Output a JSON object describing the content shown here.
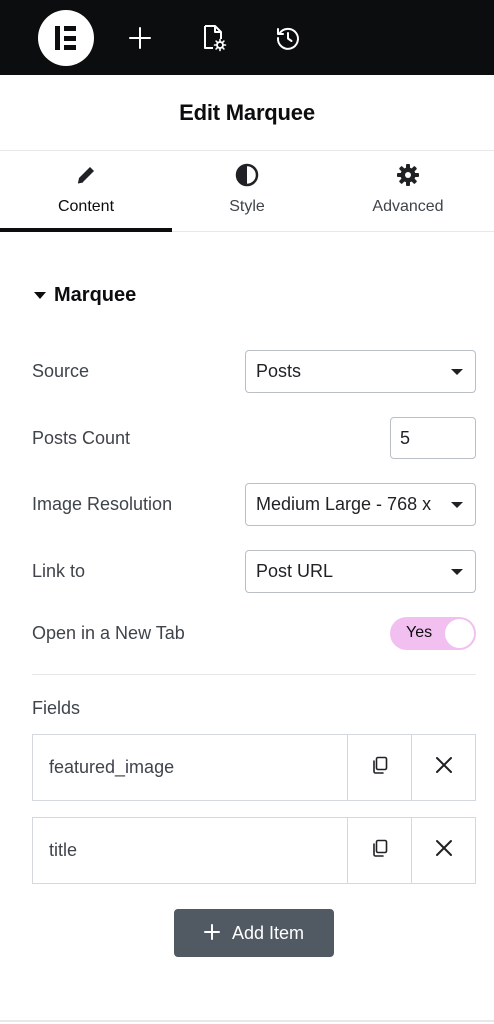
{
  "topbar": {
    "logo": "elementor-logo",
    "icons": [
      "plus-icon",
      "page-settings-icon",
      "history-icon"
    ]
  },
  "header": {
    "title": "Edit Marquee"
  },
  "tabs": [
    {
      "label": "Content",
      "icon": "pencil-icon",
      "active": true
    },
    {
      "label": "Style",
      "icon": "half-circle-icon",
      "active": false
    },
    {
      "label": "Advanced",
      "icon": "gear-icon",
      "active": false
    }
  ],
  "section": {
    "title": "Marquee",
    "expanded": true
  },
  "controls": {
    "source": {
      "label": "Source",
      "value": "Posts"
    },
    "posts_count": {
      "label": "Posts Count",
      "value": "5"
    },
    "image_resolution": {
      "label": "Image Resolution",
      "value": "Medium Large - 768 x"
    },
    "link_to": {
      "label": "Link to",
      "value": "Post URL"
    },
    "new_tab": {
      "label": "Open in a New Tab",
      "value": "Yes",
      "on": true
    }
  },
  "fields": {
    "label": "Fields",
    "items": [
      {
        "name": "featured_image"
      },
      {
        "name": "title"
      }
    ],
    "add_label": "Add Item"
  },
  "colors": {
    "topbar": "#0c0d0e",
    "toggle_on": "#f2c0f0",
    "add_button": "#515962"
  }
}
